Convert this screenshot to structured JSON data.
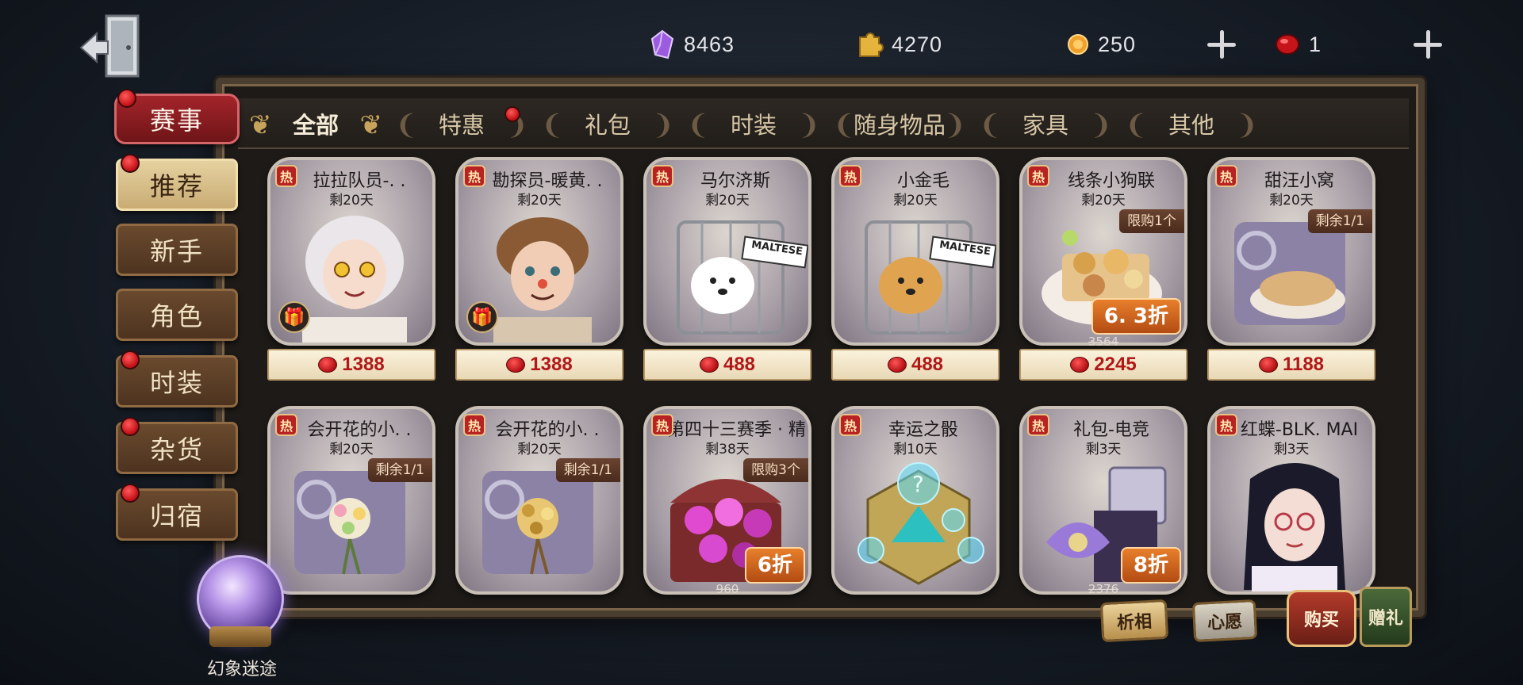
{
  "currencies": [
    {
      "icon": "purple-gem-icon",
      "value": "8463"
    },
    {
      "icon": "puzzle-piece-icon",
      "value": "4270"
    },
    {
      "icon": "echo-coin-icon",
      "value": "250"
    },
    {
      "icon": "red-ticket-icon",
      "value": "1"
    }
  ],
  "tabs": [
    "全部",
    "特惠",
    "礼包",
    "时装",
    "随身物品",
    "家具",
    "其他"
  ],
  "sidebar": [
    "赛事",
    "推荐",
    "新手",
    "角色",
    "时装",
    "杂货",
    "归宿"
  ],
  "hot_badge": "热",
  "items": [
    {
      "title": "拉拉队员-. .",
      "days": "剩20天",
      "price": "1388",
      "gift": true
    },
    {
      "title": "勘探员-暖黄. .",
      "days": "剩20天",
      "price": "1388",
      "gift": true
    },
    {
      "title": "马尔济斯",
      "days": "剩20天",
      "price": "488",
      "sign": "MALTESE"
    },
    {
      "title": "小金毛",
      "days": "剩20天",
      "price": "488",
      "sign": "MALTESE"
    },
    {
      "title": "线条小狗联",
      "days": "剩20天",
      "price": "2245",
      "limit": "限购1个",
      "discount": "6. 3折",
      "original": "3564"
    },
    {
      "title": "甜汪小窝",
      "days": "剩20天",
      "price": "1188",
      "limit": "剩余1/1"
    },
    {
      "title": "会开花的小. .",
      "days": "剩20天",
      "limit": "剩余1/1"
    },
    {
      "title": "会开花的小. .",
      "days": "剩20天",
      "limit": "剩余1/1"
    },
    {
      "title": "第四十三赛季 · 精",
      "days": "剩38天",
      "limit": "限购3个",
      "discount": "6折",
      "original": "960"
    },
    {
      "title": "幸运之骰",
      "days": "剩10天"
    },
    {
      "title": "礼包-电竞",
      "days": "剩3天",
      "discount": "8折",
      "original": "2376"
    },
    {
      "title": "红蝶-BLK. MAI",
      "days": "剩3天"
    }
  ],
  "orb_label": "幻象迷途",
  "bottom_buttons": [
    "析相",
    "心愿",
    "购买",
    "赠礼"
  ],
  "colors": {
    "price_red": "#b11818",
    "discount_orange": "#d9661e",
    "frame_brown": "#4a3e30"
  }
}
